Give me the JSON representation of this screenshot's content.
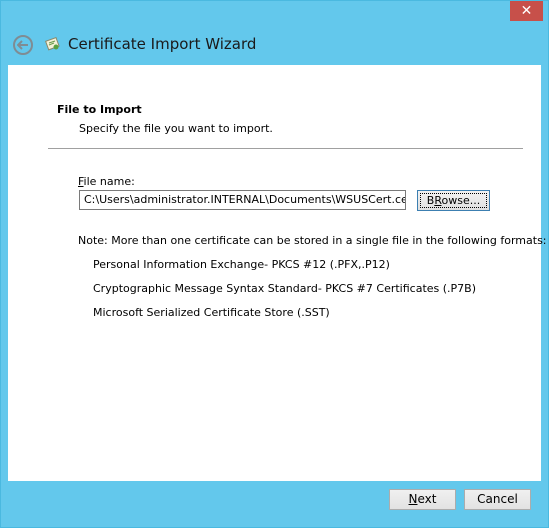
{
  "window": {
    "close_glyph": "✕"
  },
  "header": {
    "title": "Certificate Import Wizard",
    "back_icon": "back-arrow-icon",
    "app_icon": "certificate-icon"
  },
  "page": {
    "section_title": "File to Import",
    "section_subtitle": "Specify the file you want to import.",
    "file_label_accel": "F",
    "file_label_rest": "ile name:",
    "file_value": "C:\\Users\\administrator.INTERNAL\\Documents\\WSUSCert.cer",
    "browse_accel": "R",
    "browse_pre": "B",
    "browse_post": "owse...",
    "note": "Note:  More than one certificate can be stored in a single file in the following formats:",
    "formats": [
      "Personal Information Exchange- PKCS #12 (.PFX,.P12)",
      "Cryptographic Message Syntax Standard- PKCS #7 Certificates (.P7B)",
      "Microsoft Serialized Certificate Store (.SST)"
    ]
  },
  "footer": {
    "next_accel": "N",
    "next_rest": "ext",
    "cancel_label": "Cancel"
  },
  "colors": {
    "frame": "#63c8ec",
    "close": "#c7504a"
  }
}
